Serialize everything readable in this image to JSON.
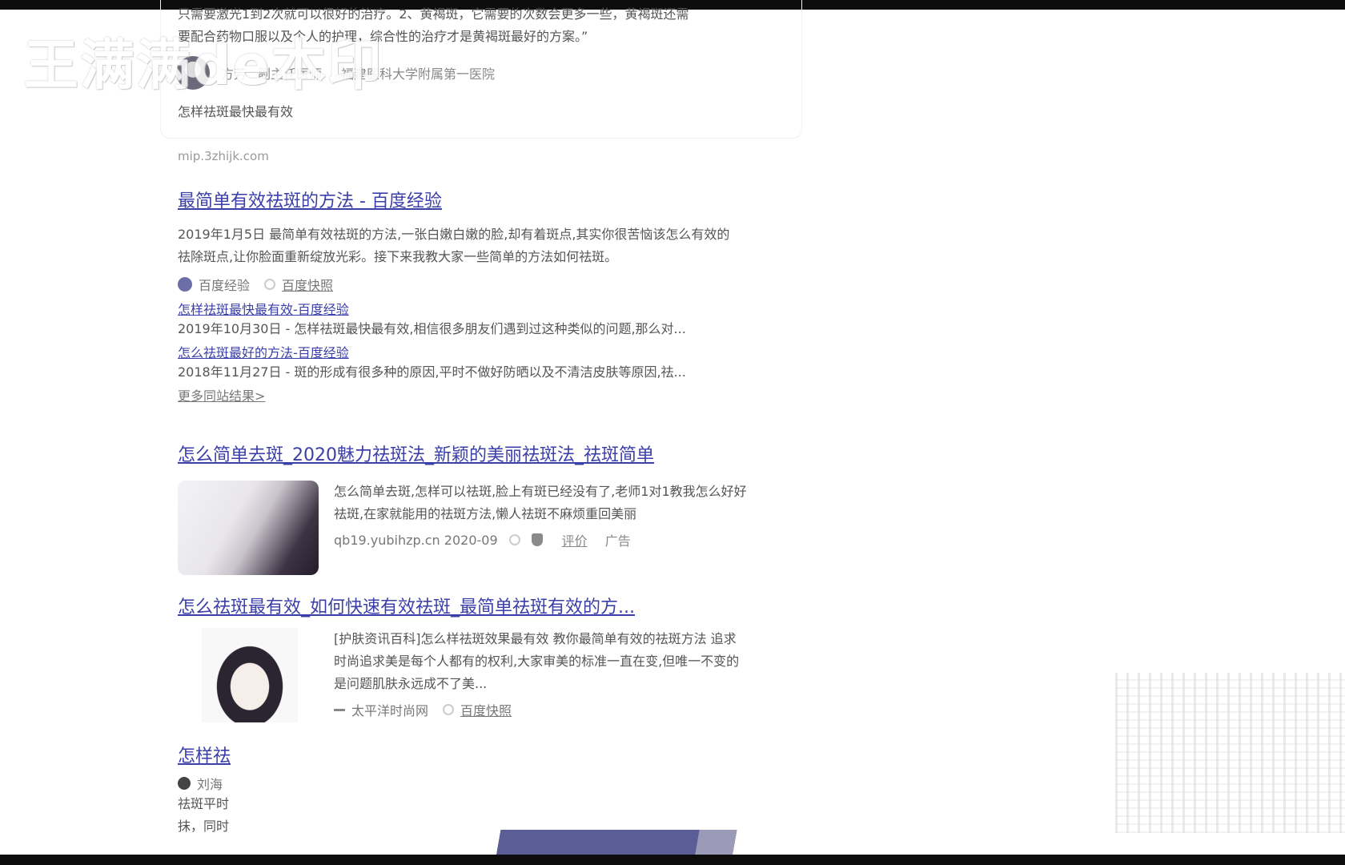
{
  "watermark": "王满满de本印",
  "card": {
    "snippet_line1": "只需要激光1到2次就可以很好的治疗。2、黄褐斑，它需要的次数会更多一些，黄褐斑还需",
    "snippet_line2": "要配合药物口服以及个人的护理，综合性的治疗才是黄褐斑最好的方案。”",
    "doctor_name": "方芳",
    "doctor_title": "副主任医师",
    "hospital": "福建医科大学附属第一医院",
    "related_query": "怎样祛斑最快最有效"
  },
  "mip_url": "mip.3zhijk.com",
  "result1": {
    "title": "最简单有效祛斑的方法 - 百度经验",
    "abstract_line1": "2019年1月5日  最简单有效祛斑的方法,一张白嫩白嫩的脸,却有着斑点,其实你很苦恼该怎么有效的",
    "abstract_line2": "祛除斑点,让你脸面重新绽放光彩。接下来我教大家一些简单的方法如何祛斑。",
    "source": "百度经验",
    "snapshot": "百度快照",
    "sub1_title": "怎样祛斑最快最有效-百度经验",
    "sub1_desc": "2019年10月30日 - 怎样祛斑最快最有效,相信很多朋友们遇到过这种类似的问题,那么对...",
    "sub2_title": "怎么祛斑最好的方法-百度经验",
    "sub2_desc": "2018年11月27日 - 斑的形成有很多种的原因,平时不做好防晒以及不清洁皮肤等原因,祛...",
    "more": "更多同站结果>"
  },
  "result2": {
    "title": "怎么简单去斑_2020魅力祛斑法_新颖的美丽祛斑法_祛斑简单",
    "abstract_line1": "怎么简单去斑,怎样可以祛斑,脸上有斑已经没有了,老师1对1教我怎么好好",
    "abstract_line2": "祛斑,在家就能用的祛斑方法,懒人祛斑不麻烦重回美丽",
    "url": "qb19.yubihzp.cn  2020-09",
    "review": "评价",
    "ad": "广告"
  },
  "result3": {
    "title": "怎么祛斑最有效_如何快速有效祛斑_最简单祛斑有效的方...",
    "abstract_line1": "[护肤资讯百科]怎么样祛斑效果最有效 教你最简单有效的祛斑方法 追求",
    "abstract_line2": "时尚追求美是每个人都有的权利,大家审美的标准一直在变,但唯一不变的",
    "abstract_line3": "是问题肌肤永远成不了美...",
    "source": "太平洋时尚网",
    "snapshot": "百度快照"
  },
  "result4": {
    "title": "怎样祛",
    "author": "刘海",
    "line1": "祛斑平时",
    "line2": "抹，同时"
  }
}
